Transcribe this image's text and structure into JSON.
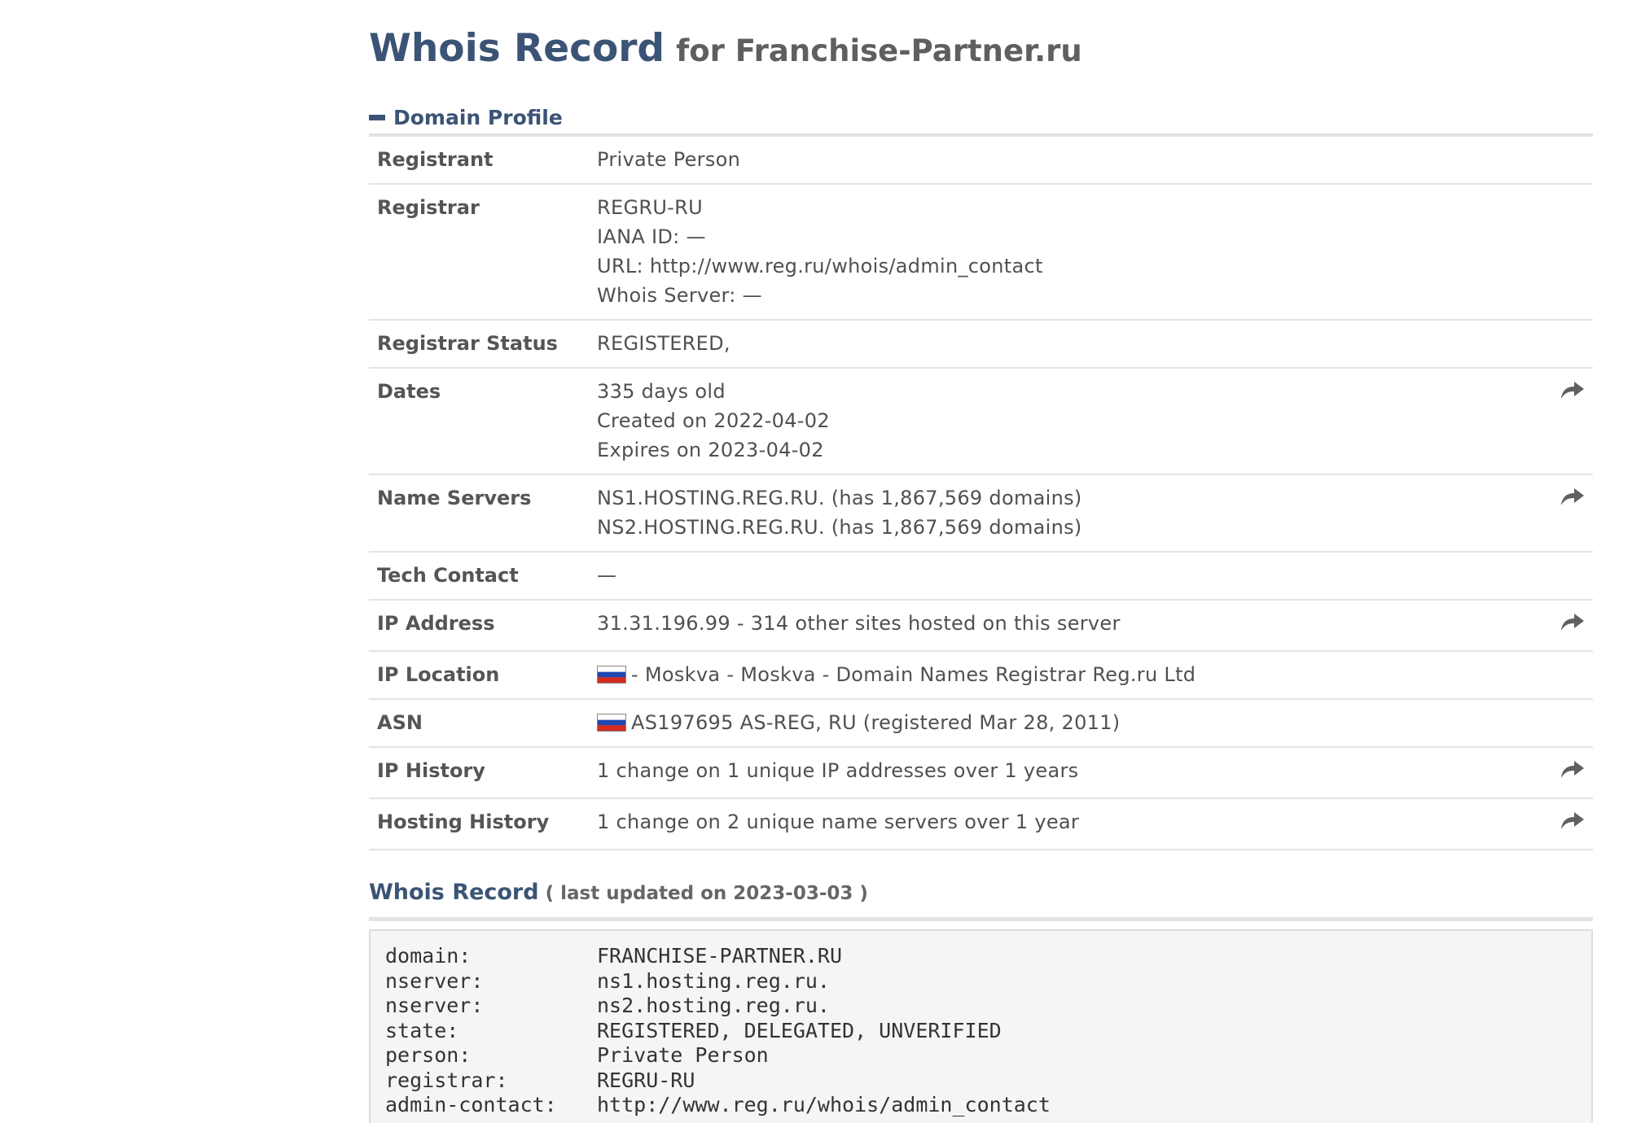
{
  "title": {
    "main": "Whois Record",
    "sub": "for Franchise-Partner.ru"
  },
  "domain_profile": {
    "header": "Domain Profile",
    "rows": [
      {
        "label": "Registrant",
        "lines": [
          "Private Person"
        ],
        "share": false
      },
      {
        "label": "Registrar",
        "lines": [
          "REGRU-RU",
          "IANA ID: —",
          "URL: http://www.reg.ru/whois/admin_contact",
          "Whois Server: —"
        ],
        "share": false
      },
      {
        "label": "Registrar Status",
        "lines": [
          "REGISTERED,"
        ],
        "share": false
      },
      {
        "label": "Dates",
        "lines": [
          "335 days old",
          "Created on 2022-04-02",
          "Expires on 2023-04-02"
        ],
        "share": true
      },
      {
        "label": "Name Servers",
        "lines": [
          "NS1.HOSTING.REG.RU. (has 1,867,569 domains)",
          "NS2.HOSTING.REG.RU. (has 1,867,569 domains)"
        ],
        "share": true
      },
      {
        "label": "Tech Contact",
        "lines": [
          "—"
        ],
        "share": false
      },
      {
        "label": "IP Address",
        "lines": [
          "31.31.196.99 - 314 other sites hosted on this server"
        ],
        "share": true
      },
      {
        "label": "IP Location",
        "lines": [
          "- Moskva - Moskva - Domain Names Registrar Reg.ru Ltd"
        ],
        "flag": "russia-flag-icon",
        "share": false
      },
      {
        "label": "ASN",
        "lines": [
          "AS197695 AS-REG, RU (registered Mar 28, 2011)"
        ],
        "flag": "russia-flag-icon",
        "share": false
      },
      {
        "label": "IP History",
        "lines": [
          "1 change on 1 unique IP addresses over 1 years"
        ],
        "share": true
      },
      {
        "label": "Hosting History",
        "lines": [
          "1 change on 2 unique name servers over 1 year"
        ],
        "share": true
      }
    ]
  },
  "whois_record": {
    "header": "Whois Record",
    "meta": "( last updated on 2023-03-03 )",
    "raw": [
      {
        "key": "domain:",
        "value": "FRANCHISE-PARTNER.RU"
      },
      {
        "key": "nserver:",
        "value": "ns1.hosting.reg.ru."
      },
      {
        "key": "nserver:",
        "value": "ns2.hosting.reg.ru."
      },
      {
        "key": "state:",
        "value": "REGISTERED, DELEGATED, UNVERIFIED"
      },
      {
        "key": "person:",
        "value": "Private Person"
      },
      {
        "key": "registrar:",
        "value": "REGRU-RU"
      },
      {
        "key": "admin-contact:",
        "value": "http://www.reg.ru/whois/admin_contact"
      }
    ]
  },
  "icons": {
    "share": "share-arrow-icon",
    "collapse": "minus-icon"
  },
  "colors": {
    "accent": "#3b5475",
    "flag_white": "#ffffff",
    "flag_blue": "#1f47b0",
    "flag_red": "#d52b1e"
  }
}
